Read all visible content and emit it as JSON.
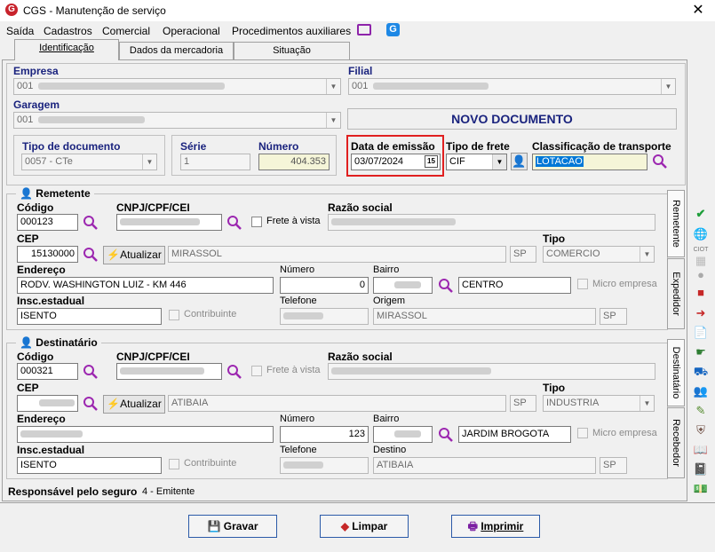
{
  "window": {
    "title": "CGS - Manutenção de serviço",
    "logo_letter": "G"
  },
  "menu": [
    "Saída",
    "Cadastros",
    "Comercial",
    "Operacional",
    "Procedimentos auxiliares"
  ],
  "tabs": [
    "Identificação",
    "Dados da mercadoria",
    "Situação"
  ],
  "empresa": {
    "label": "Empresa",
    "value": "001"
  },
  "filial": {
    "label": "Filial",
    "value": "001"
  },
  "garagem": {
    "label": "Garagem",
    "value": "001"
  },
  "status_banner": "NOVO DOCUMENTO",
  "tipo_documento": {
    "label": "Tipo de documento",
    "value": "0057 - CTe"
  },
  "serie": {
    "label": "Série",
    "value": "1"
  },
  "numero": {
    "label": "Número",
    "value": "404.353"
  },
  "data_emissao": {
    "label": "Data de emissão",
    "value": "03/07/2024",
    "cal_label": "15"
  },
  "tipo_frete": {
    "label": "Tipo de frete",
    "value": "CIF"
  },
  "classificacao": {
    "label": "Classificação de transporte",
    "value": "LOTACAO"
  },
  "remetente": {
    "title": "Remetente",
    "codigo_label": "Código",
    "codigo": "000123",
    "cnpj_label": "CNPJ/CPF/CEI",
    "frete_vista": "Frete à vista",
    "razao_label": "Razão social",
    "cep_label": "CEP",
    "cep": "15130000",
    "atualizar": "Atualizar",
    "cidade": "MIRASSOL",
    "uf": "SP",
    "tipo_label": "Tipo",
    "tipo": "COMERCIO",
    "endereco_label": "Endereço",
    "endereco": "RODV. WASHINGTON LUIZ  - KM 446",
    "numero_label": "Número",
    "numero": "0",
    "bairro_label": "Bairro",
    "bairro": "CENTRO",
    "micro_empresa": "Micro empresa",
    "insc_label": "Insc.estadual",
    "insc": "ISENTO",
    "contribuinte": "Contribuinte",
    "telefone_label": "Telefone",
    "origem_label": "Origem",
    "origem": "MIRASSOL",
    "origem_uf": "SP"
  },
  "destinatario": {
    "title": "Destinatário",
    "codigo_label": "Código",
    "codigo": "000321",
    "cnpj_label": "CNPJ/CPF/CEI",
    "frete_vista": "Frete à vista",
    "razao_label": "Razão social",
    "cep_label": "CEP",
    "atualizar": "Atualizar",
    "cidade": "ATIBAIA",
    "uf": "SP",
    "tipo_label": "Tipo",
    "tipo": "INDUSTRIA",
    "endereco_label": "Endereço",
    "numero_label": "Número",
    "numero": "123",
    "bairro_label": "Bairro",
    "bairro": "JARDIM BROGOTA",
    "micro_empresa": "Micro empresa",
    "insc_label": "Insc.estadual",
    "insc": "ISENTO",
    "contribuinte": "Contribuinte",
    "telefone_label": "Telefone",
    "destino_label": "Destino",
    "destino": "ATIBAIA",
    "destino_uf": "SP"
  },
  "side_tabs_top": [
    "Remetente",
    "Expedidor"
  ],
  "side_tabs_bottom": [
    "Destinatário",
    "Recebedor"
  ],
  "responsavel": {
    "label": "Responsável pelo seguro",
    "value": "4 - Emitente"
  },
  "buttons": {
    "gravar": "Gravar",
    "limpar": "Limpar",
    "imprimir": "Imprimir"
  },
  "toolbar_icon_text": "CIOT",
  "colors": {
    "highlight_border": "#e02020",
    "selection": "#0078d7",
    "banner_text": "#1a237e"
  }
}
